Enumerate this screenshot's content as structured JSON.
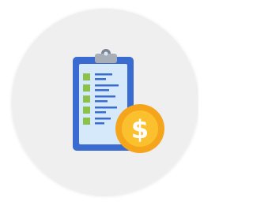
{
  "icon": {
    "name": "clipboard-invoice-dollar-icon",
    "glyph": "$"
  },
  "colors": {
    "page_background": "#ffffff",
    "badge_circle": "#efefef",
    "clipboard_board": "#3a6bd1",
    "paper": "#d6e9fb",
    "clip": "#a8aeb8",
    "clip_dark": "#7d8591",
    "checkbox": "#8bc34a",
    "text_line": "#3a6bd1",
    "coin_outer": "#f5a51c",
    "coin_inner": "#fbc02d",
    "coin_symbol": "#ffffff"
  },
  "checklist_rows": 5
}
